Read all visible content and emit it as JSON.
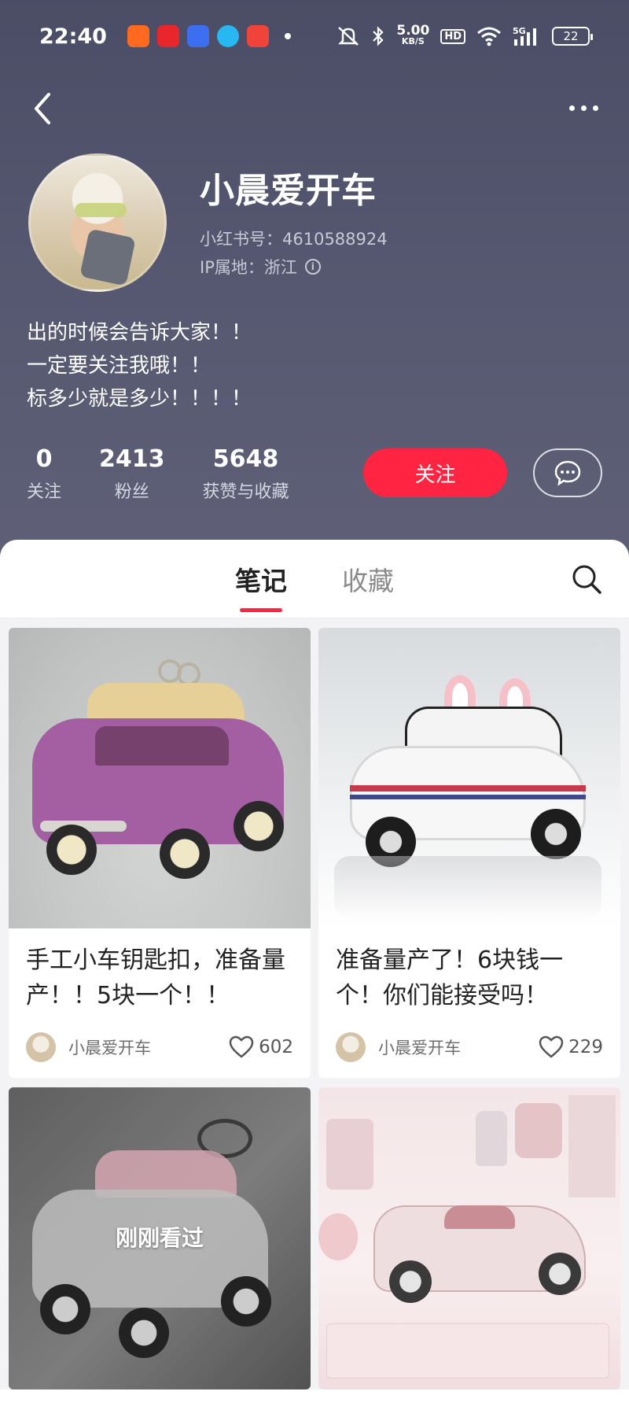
{
  "status_bar": {
    "time": "22:40",
    "net_speed": "5.00",
    "net_unit": "KB/S",
    "hd": "HD",
    "network": "5G",
    "battery": "22"
  },
  "profile": {
    "name": "小晨爱开车",
    "red_id": "小红书号：4610588924",
    "ip_location": "IP属地：浙江",
    "bio_lines": [
      "出的时候会告诉大家！！",
      "一定要关注我哦！！",
      "标多少就是多少！！！！"
    ],
    "stats": [
      {
        "value": "0",
        "label": "关注"
      },
      {
        "value": "2413",
        "label": "粉丝"
      },
      {
        "value": "5648",
        "label": "获赞与收藏"
      }
    ],
    "follow_label": "关注"
  },
  "tabs": [
    {
      "label": "笔记",
      "active": true
    },
    {
      "label": "收藏",
      "active": false
    }
  ],
  "notes": [
    {
      "title": "手工小车钥匙扣，准备量产！！5块一个！！",
      "author": "小晨爱开车",
      "likes": "602"
    },
    {
      "title": "准备量产了！6块钱一个！你们能接受吗！",
      "author": "小晨爱开车",
      "likes": "229"
    },
    {
      "overlay": "刚刚看过"
    },
    {}
  ],
  "colors": {
    "brand": "#ff2442",
    "header_bg": "#52546c"
  },
  "icons": [
    "back-icon",
    "more-icon",
    "info-icon",
    "chat-icon",
    "search-icon",
    "heart-icon"
  ]
}
